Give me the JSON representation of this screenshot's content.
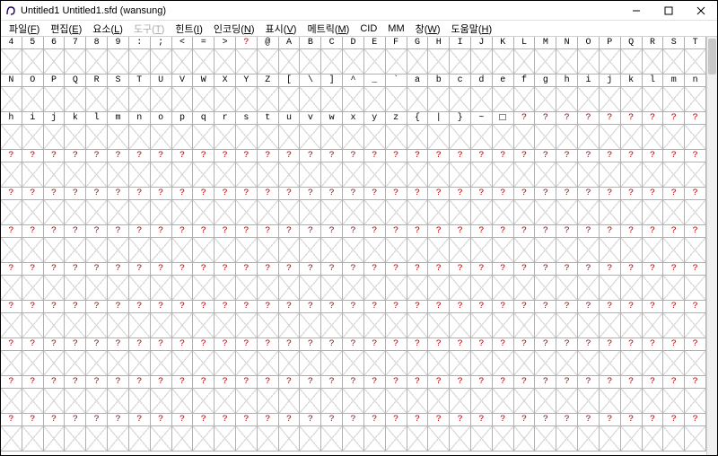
{
  "window": {
    "title": "Untitled1  Untitled1.sfd (wansung)"
  },
  "menu": {
    "items": [
      {
        "label": "파일(F)",
        "enabled": true
      },
      {
        "label": "편집(E)",
        "enabled": true
      },
      {
        "label": "요소(L)",
        "enabled": true
      },
      {
        "label": "도구(T)",
        "enabled": false
      },
      {
        "label": "힌트(I)",
        "enabled": true
      },
      {
        "label": "인코딩(N)",
        "enabled": true
      },
      {
        "label": "표시(V)",
        "enabled": true
      },
      {
        "label": "메트릭(M)",
        "enabled": true
      },
      {
        "label": "CID",
        "enabled": true
      },
      {
        "label": "MM",
        "enabled": true
      },
      {
        "label": "창(W)",
        "enabled": true
      },
      {
        "label": "도움말(H)",
        "enabled": true
      }
    ]
  },
  "grid": {
    "columns": 33,
    "row_count_visible": 11,
    "unknown_glyph_marker": "?",
    "headers": [
      [
        "4",
        "5",
        "6",
        "7",
        "8",
        "9",
        ":",
        ";",
        "<",
        "=",
        ">",
        "?",
        "@",
        "A",
        "B",
        "C",
        "D",
        "E",
        "F",
        "G",
        "H",
        "I",
        "J",
        "K",
        "L",
        "M",
        "N",
        "O",
        "P",
        "Q",
        "R",
        "S",
        "T"
      ],
      [
        "N",
        "O",
        "P",
        "Q",
        "R",
        "S",
        "T",
        "U",
        "V",
        "W",
        "X",
        "Y",
        "Z",
        "[",
        "\\",
        "]",
        "^",
        "_",
        "`",
        "a",
        "b",
        "c",
        "d",
        "e",
        "f",
        "g",
        "h",
        "i",
        "j",
        "k",
        "l",
        "m",
        "n"
      ],
      [
        "h",
        "i",
        "j",
        "k",
        "l",
        "m",
        "n",
        "o",
        "p",
        "q",
        "r",
        "s",
        "t",
        "u",
        "v",
        "w",
        "x",
        "y",
        "z",
        "{",
        "|",
        "}",
        "~",
        "□",
        "?",
        "?",
        "?",
        "?",
        "?",
        "?",
        "?",
        "?",
        "?"
      ],
      [
        "?",
        "?",
        "?",
        "?",
        "?",
        "?",
        "?",
        "?",
        "?",
        "?",
        "?",
        "?",
        "?",
        "?",
        "?",
        "?",
        "?",
        "?",
        "?",
        "?",
        "?",
        "?",
        "?",
        "?",
        "?",
        "?",
        "?",
        "?",
        "?",
        "?",
        "?",
        "?",
        "?"
      ],
      [
        "?",
        "?",
        "?",
        "?",
        "?",
        "?",
        "?",
        "?",
        "?",
        "?",
        "?",
        "?",
        "?",
        "?",
        "?",
        "?",
        "?",
        "?",
        "?",
        "?",
        "?",
        "?",
        "?",
        "?",
        "?",
        "?",
        "?",
        "?",
        "?",
        "?",
        "?",
        "?",
        "?"
      ],
      [
        "?",
        "?",
        "?",
        "?",
        "?",
        "?",
        "?",
        "?",
        "?",
        "?",
        "?",
        "?",
        "?",
        "?",
        "?",
        "?",
        "?",
        "?",
        "?",
        "?",
        "?",
        "?",
        "?",
        "?",
        "?",
        "?",
        "?",
        "?",
        "?",
        "?",
        "?",
        "?",
        "?"
      ],
      [
        "?",
        "?",
        "?",
        "?",
        "?",
        "?",
        "?",
        "?",
        "?",
        "?",
        "?",
        "?",
        "?",
        "?",
        "?",
        "?",
        "?",
        "?",
        "?",
        "?",
        "?",
        "?",
        "?",
        "?",
        "?",
        "?",
        "?",
        "?",
        "?",
        "?",
        "?",
        "?",
        "?"
      ],
      [
        "?",
        "?",
        "?",
        "?",
        "?",
        "?",
        "?",
        "?",
        "?",
        "?",
        "?",
        "?",
        "?",
        "?",
        "?",
        "?",
        "?",
        "?",
        "?",
        "?",
        "?",
        "?",
        "?",
        "?",
        "?",
        "?",
        "?",
        "?",
        "?",
        "?",
        "?",
        "?",
        "?"
      ],
      [
        "?",
        "?",
        "?",
        "?",
        "?",
        "?",
        "?",
        "?",
        "?",
        "?",
        "?",
        "?",
        "?",
        "?",
        "?",
        "?",
        "?",
        "?",
        "?",
        "?",
        "?",
        "?",
        "?",
        "?",
        "?",
        "?",
        "?",
        "?",
        "?",
        "?",
        "?",
        "?",
        "?"
      ],
      [
        "?",
        "?",
        "?",
        "?",
        "?",
        "?",
        "?",
        "?",
        "?",
        "?",
        "?",
        "?",
        "?",
        "?",
        "?",
        "?",
        "?",
        "?",
        "?",
        "?",
        "?",
        "?",
        "?",
        "?",
        "?",
        "?",
        "?",
        "?",
        "?",
        "?",
        "?",
        "?",
        "?"
      ],
      [
        "?",
        "?",
        "?",
        "?",
        "?",
        "?",
        "?",
        "?",
        "?",
        "?",
        "?",
        "?",
        "?",
        "?",
        "?",
        "?",
        "?",
        "?",
        "?",
        "?",
        "?",
        "?",
        "?",
        "?",
        "?",
        "?",
        "?",
        "?",
        "?",
        "?",
        "?",
        "?",
        "?"
      ]
    ],
    "special_box_cell": {
      "row": 2,
      "col": 23
    }
  },
  "colors": {
    "unknown_marker": "#b00000",
    "grid_line": "#b0b0b0",
    "empty_x": "#d8d8d8"
  }
}
